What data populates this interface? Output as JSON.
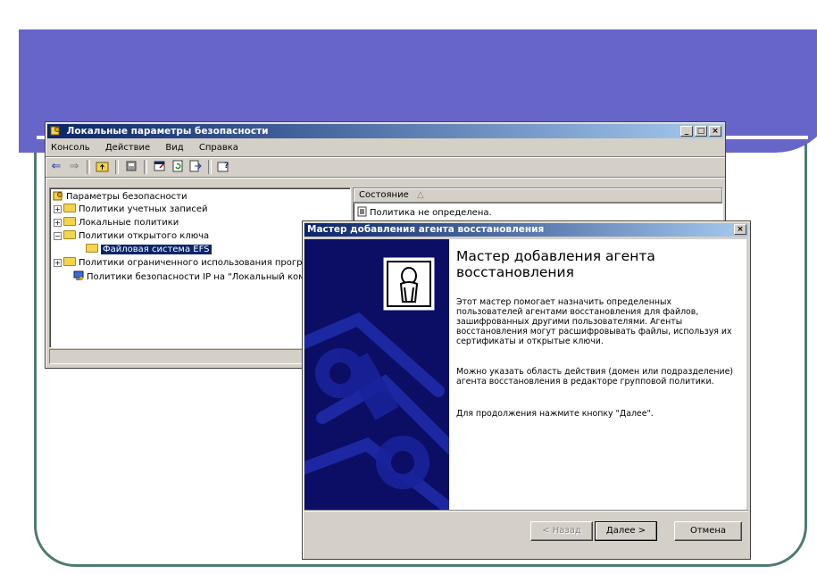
{
  "colors": {
    "banner": "#6766c8",
    "frame": "#4e7a73",
    "titlebar": "#0a246a",
    "wizard_side": "#0b0e64"
  },
  "mmc": {
    "title": "Локальные параметры безопасности",
    "window_buttons": [
      "_",
      "□",
      "×"
    ],
    "menu": [
      "Консоль",
      "Действие",
      "Вид",
      "Справка"
    ],
    "toolbar_icons": [
      "back-arrow-icon",
      "forward-arrow-icon",
      "up-folder-icon",
      "delete-icon",
      "properties-icon",
      "refresh-icon",
      "export-icon",
      "help-icon"
    ],
    "tree": {
      "root": "Параметры безопасности",
      "items": [
        {
          "label": "Политики учетных записей",
          "expander": "+"
        },
        {
          "label": "Локальные политики",
          "expander": "+"
        },
        {
          "label": "Политики открытого ключа",
          "expander": "−"
        },
        {
          "label": "Файловая система EFS",
          "expander": ""
        },
        {
          "label": "Политики ограниченного использования програ",
          "expander": "+"
        },
        {
          "label": "Политики безопасности IP на \"Локальный компь",
          "expander": ""
        }
      ]
    },
    "details": {
      "column_header": "Состояние",
      "sort_indicator": "△",
      "row": "Политика не определена."
    }
  },
  "wizard": {
    "title": "Мастер добавления агента восстановления",
    "close": "×",
    "heading": "Мастер добавления агента восстановления",
    "paragraph1": "Этот мастер помогает назначить определенных пользователей агентами восстановления для файлов, зашифрованных другими пользователями. Агенты восстановления могут расшифровывать файлы, используя их сертификаты и открытые ключи.",
    "paragraph2": "Можно указать область действия (домен или подразделение) агента восстановления в редакторе групповой политики.",
    "paragraph3": "Для продолжения нажмите кнопку \"Далее\".",
    "back_button": "< Назад",
    "next_button": "Далее >",
    "cancel_button": "Отмена"
  }
}
